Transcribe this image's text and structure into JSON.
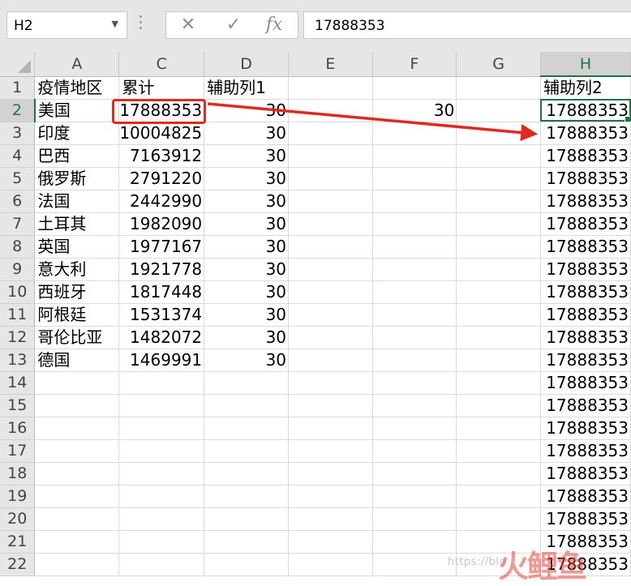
{
  "formula_bar": {
    "name_box": "H2",
    "fx_label": "fx",
    "cancel_icon": "close-icon",
    "enter_icon": "checkmark-icon",
    "formula": "17888353"
  },
  "columns": [
    "A",
    "C",
    "D",
    "E",
    "F",
    "G",
    "H"
  ],
  "selected_column": "H",
  "rows": [
    {
      "n": "1",
      "A": "疫情地区",
      "C": "累计",
      "D": "辅助列1",
      "E": "",
      "F": "",
      "G": "",
      "H": "辅助列2"
    },
    {
      "n": "2",
      "A": "美国",
      "C": "17888353",
      "D": "30",
      "E": "",
      "F": "30",
      "G": "",
      "H": "17888353"
    },
    {
      "n": "3",
      "A": "印度",
      "C": "10004825",
      "D": "30",
      "E": "",
      "F": "",
      "G": "",
      "H": "17888353"
    },
    {
      "n": "4",
      "A": "巴西",
      "C": "7163912",
      "D": "30",
      "E": "",
      "F": "",
      "G": "",
      "H": "17888353"
    },
    {
      "n": "5",
      "A": "俄罗斯",
      "C": "2791220",
      "D": "30",
      "E": "",
      "F": "",
      "G": "",
      "H": "17888353"
    },
    {
      "n": "6",
      "A": "法国",
      "C": "2442990",
      "D": "30",
      "E": "",
      "F": "",
      "G": "",
      "H": "17888353"
    },
    {
      "n": "7",
      "A": "土耳其",
      "C": "1982090",
      "D": "30",
      "E": "",
      "F": "",
      "G": "",
      "H": "17888353"
    },
    {
      "n": "8",
      "A": "英国",
      "C": "1977167",
      "D": "30",
      "E": "",
      "F": "",
      "G": "",
      "H": "17888353"
    },
    {
      "n": "9",
      "A": "意大利",
      "C": "1921778",
      "D": "30",
      "E": "",
      "F": "",
      "G": "",
      "H": "17888353"
    },
    {
      "n": "10",
      "A": "西班牙",
      "C": "1817448",
      "D": "30",
      "E": "",
      "F": "",
      "G": "",
      "H": "17888353"
    },
    {
      "n": "11",
      "A": "阿根廷",
      "C": "1531374",
      "D": "30",
      "E": "",
      "F": "",
      "G": "",
      "H": "17888353"
    },
    {
      "n": "12",
      "A": "哥伦比亚",
      "C": "1482072",
      "D": "30",
      "E": "",
      "F": "",
      "G": "",
      "H": "17888353"
    },
    {
      "n": "13",
      "A": "德国",
      "C": "1469991",
      "D": "30",
      "E": "",
      "F": "",
      "G": "",
      "H": "17888353"
    },
    {
      "n": "14",
      "A": "",
      "C": "",
      "D": "",
      "E": "",
      "F": "",
      "G": "",
      "H": "17888353"
    },
    {
      "n": "15",
      "A": "",
      "C": "",
      "D": "",
      "E": "",
      "F": "",
      "G": "",
      "H": "17888353"
    },
    {
      "n": "16",
      "A": "",
      "C": "",
      "D": "",
      "E": "",
      "F": "",
      "G": "",
      "H": "17888353"
    },
    {
      "n": "17",
      "A": "",
      "C": "",
      "D": "",
      "E": "",
      "F": "",
      "G": "",
      "H": "17888353"
    },
    {
      "n": "18",
      "A": "",
      "C": "",
      "D": "",
      "E": "",
      "F": "",
      "G": "",
      "H": "17888353"
    },
    {
      "n": "19",
      "A": "",
      "C": "",
      "D": "",
      "E": "",
      "F": "",
      "G": "",
      "H": "17888353"
    },
    {
      "n": "20",
      "A": "",
      "C": "",
      "D": "",
      "E": "",
      "F": "",
      "G": "",
      "H": "17888353"
    },
    {
      "n": "21",
      "A": "",
      "C": "",
      "D": "",
      "E": "",
      "F": "",
      "G": "",
      "H": "17888353"
    },
    {
      "n": "22",
      "A": "",
      "C": "",
      "D": "",
      "E": "",
      "F": "",
      "G": "",
      "H": "17888353"
    }
  ],
  "selected_cell": {
    "row": "2",
    "col": "H"
  },
  "annotation_color": "#e02a20",
  "selection_color": "#217346",
  "watermark": {
    "url": "https://blo",
    "logo": "火鲤鱼"
  }
}
